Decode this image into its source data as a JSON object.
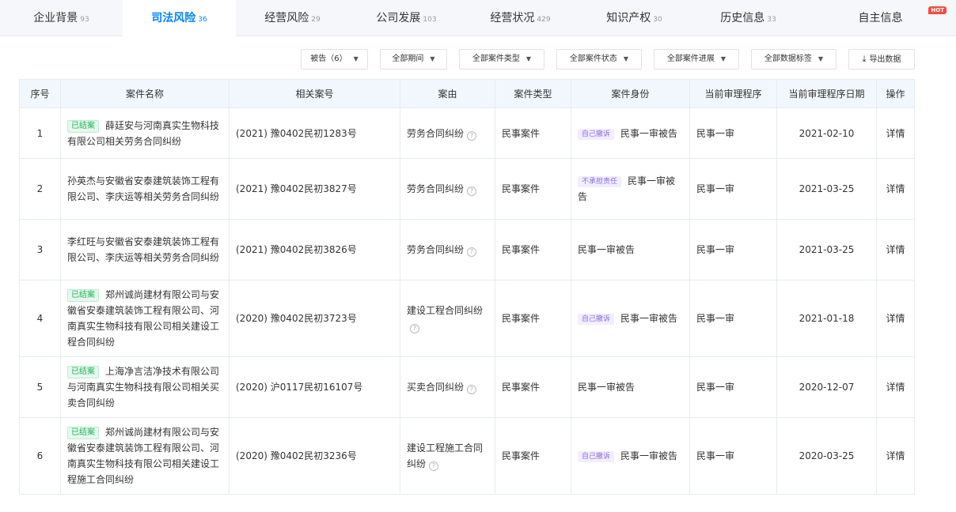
{
  "tabs": [
    {
      "label": "企业背景",
      "count": "93",
      "active": false
    },
    {
      "label": "司法风险",
      "count": "36",
      "active": true
    },
    {
      "label": "经营风险",
      "count": "29",
      "active": false
    },
    {
      "label": "公司发展",
      "count": "103",
      "active": false
    },
    {
      "label": "经营状况",
      "count": "429",
      "active": false
    },
    {
      "label": "知识产权",
      "count": "30",
      "active": false
    },
    {
      "label": "历史信息",
      "count": "33",
      "active": false
    },
    {
      "label": "自主信息",
      "count": "",
      "active": false,
      "badge": "HOT"
    }
  ],
  "filters": [
    "被告（6）",
    "全部期间",
    "全部案件类型",
    "全部案件状态",
    "全部案件进展",
    "全部数据标签"
  ],
  "export_label": "导出数据",
  "table": {
    "columns": [
      "序号",
      "案件名称",
      "相关案号",
      "案由",
      "案件类型",
      "案件身份",
      "当前审理程序",
      "当前审理程序日期",
      "操作"
    ],
    "rows": [
      {
        "idx": "1",
        "status": "已结案",
        "name": "薛廷安与河南真实生物科技有限公司相关劳务合同纠纷",
        "case_no": "(2021) 豫0402民初1283号",
        "cause": "劳务合同纠纷",
        "type": "民事案件",
        "role_tag": "自己撤诉",
        "role": "民事一审被告",
        "procedure": "民事一审",
        "date": "2021-02-10",
        "op": "详情"
      },
      {
        "idx": "2",
        "status": "",
        "name": "孙英杰与安徽省安泰建筑装饰工程有限公司、李庆运等相关劳务合同纠纷",
        "case_no": "(2021) 豫0402民初3827号",
        "cause": "劳务合同纠纷",
        "type": "民事案件",
        "role_tag": "不承担责任",
        "role": "民事一审被告",
        "procedure": "民事一审",
        "date": "2021-03-25",
        "op": "详情"
      },
      {
        "idx": "3",
        "status": "",
        "name": "李红旺与安徽省安泰建筑装饰工程有限公司、李庆运等相关劳务合同纠纷",
        "case_no": "(2021) 豫0402民初3826号",
        "cause": "劳务合同纠纷",
        "type": "民事案件",
        "role_tag": "",
        "role": "民事一审被告",
        "procedure": "民事一审",
        "date": "2021-03-25",
        "op": "详情"
      },
      {
        "idx": "4",
        "status": "已结案",
        "name": "郑州诚尚建材有限公司与安徽省安泰建筑装饰工程有限公司、河南真实生物科技有限公司相关建设工程合同纠纷",
        "case_no": "(2020) 豫0402民初3723号",
        "cause": "建设工程合同纠纷",
        "type": "民事案件",
        "role_tag": "自己撤诉",
        "role": "民事一审被告",
        "procedure": "民事一审",
        "date": "2021-01-18",
        "op": "详情"
      },
      {
        "idx": "5",
        "status": "已结案",
        "name": "上海净言洁净技术有限公司与河南真实生物科技有限公司相关买卖合同纠纷",
        "case_no": "(2020) 沪0117民初16107号",
        "cause": "买卖合同纠纷",
        "type": "民事案件",
        "role_tag": "",
        "role": "民事一审被告",
        "procedure": "民事一审",
        "date": "2020-12-07",
        "op": "详情"
      },
      {
        "idx": "6",
        "status": "已结案",
        "name": "郑州诚尚建材有限公司与安徽省安泰建筑装饰工程有限公司、河南真实生物科技有限公司相关建设工程施工合同纠纷",
        "case_no": "(2020) 豫0402民初3236号",
        "cause": "建设工程施工合同纠纷",
        "type": "民事案件",
        "role_tag": "自己撤诉",
        "role": "民事一审被告",
        "procedure": "民事一审",
        "date": "2020-03-25",
        "op": "详情"
      }
    ]
  }
}
